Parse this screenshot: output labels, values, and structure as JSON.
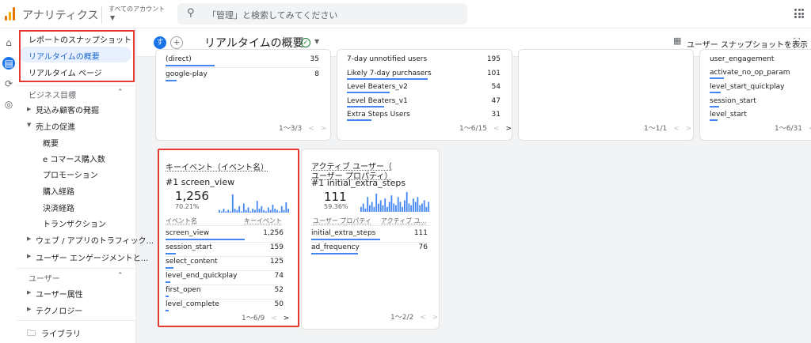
{
  "header": {
    "app_title": "アナリティクス",
    "account_label": "すべてのアカウント",
    "search_placeholder": "「管理」と検索してみてください"
  },
  "sidebar": {
    "snapshot_items": [
      {
        "label": "レポートのスナップショット"
      },
      {
        "label": "リアルタイムの概要"
      },
      {
        "label": "リアルタイム ページ"
      }
    ],
    "section_business": "ビジネス目標",
    "business_items": [
      {
        "label": "見込み顧客の発掘"
      },
      {
        "label": "売上の促進"
      }
    ],
    "sales_subitems": [
      {
        "label": "概要"
      },
      {
        "label": "e コマース購入数"
      },
      {
        "label": "プロモーション"
      },
      {
        "label": "購入経路"
      },
      {
        "label": "決済経路"
      },
      {
        "label": "トランザクション"
      }
    ],
    "other_items": [
      {
        "label": "ウェブ / アプリのトラフィック..."
      },
      {
        "label": "ユーザー エンゲージメントと..."
      }
    ],
    "section_user": "ユーザー",
    "user_items": [
      {
        "label": "ユーザー属性"
      },
      {
        "label": "テクノロジー"
      }
    ],
    "library": "ライブラリ"
  },
  "titlebar": {
    "avatar_letter": "す",
    "title": "リアルタイムの概要",
    "snapshot_label": "ユーザー スナップショットを表示"
  },
  "card1": {
    "rows": [
      {
        "label": "(direct)",
        "value": "35"
      },
      {
        "label": "google-play",
        "value": "8"
      }
    ],
    "pagination": "1～3/3"
  },
  "card2": {
    "rows": [
      {
        "label": "7-day unnotified users",
        "value": "195"
      },
      {
        "label": "Likely 7-day purchasers",
        "value": "101"
      },
      {
        "label": "Level Beaters_v2",
        "value": "54"
      },
      {
        "label": "Level Beaters_v1",
        "value": "47"
      },
      {
        "label": "Extra Steps Users",
        "value": "31"
      }
    ],
    "pagination": "1～6/15"
  },
  "card3": {
    "pagination": "1～1/1"
  },
  "card4": {
    "rows": [
      {
        "label": "user_engagement"
      },
      {
        "label": "activate_no_op_param"
      },
      {
        "label": "level_start_quickplay"
      },
      {
        "label": "session_start"
      },
      {
        "label": "level_start"
      }
    ],
    "pagination": "1～6/31"
  },
  "key_events_card": {
    "heading": "キーイベント（イベント名）",
    "top_label": "#1  screen_view",
    "top_value": "1,256",
    "top_pct": "70.21%",
    "col_left": "イベント名",
    "col_right": "キーイベント",
    "rows": [
      {
        "label": "screen_view",
        "value": "1,256",
        "frac": 1.0
      },
      {
        "label": "session_start",
        "value": "159",
        "frac": 0.127
      },
      {
        "label": "select_content",
        "value": "125",
        "frac": 0.1
      },
      {
        "label": "level_end_quickplay",
        "value": "74",
        "frac": 0.059
      },
      {
        "label": "first_open",
        "value": "52",
        "frac": 0.041
      },
      {
        "label": "level_complete",
        "value": "50",
        "frac": 0.04
      }
    ],
    "spark": [
      2,
      1,
      3,
      1,
      2,
      1,
      14,
      3,
      2,
      5,
      1,
      7,
      2,
      4,
      1,
      3,
      2,
      9,
      3,
      5,
      2,
      1,
      4,
      2,
      6,
      3,
      2,
      1,
      5,
      2,
      8,
      3
    ],
    "pagination": "1～6/9"
  },
  "active_users_card": {
    "heading_line1": "アクティブ ユーザー（",
    "heading_line2": "ユーザー プロパティ）",
    "top_label": "#1  initial_extra_steps",
    "top_value": "111",
    "top_pct": "59.36%",
    "col_left": "ユーザー プロパティ",
    "col_right": "アクティブ ユ...",
    "rows": [
      {
        "label": "initial_extra_steps",
        "value": "111",
        "frac": 1.0
      },
      {
        "label": "ad_frequency",
        "value": "76",
        "frac": 0.68
      }
    ],
    "spark": [
      3,
      5,
      2,
      9,
      4,
      6,
      3,
      11,
      5,
      7,
      4,
      8,
      3,
      6,
      10,
      5,
      4,
      9,
      6,
      3,
      7,
      12,
      5,
      4,
      8,
      6,
      9,
      4,
      5,
      7,
      3,
      6
    ],
    "pagination": "1～2/2"
  },
  "colors": {
    "accent": "#1a73e8",
    "bar": "#4285f4",
    "highlight_border": "#e53935"
  }
}
